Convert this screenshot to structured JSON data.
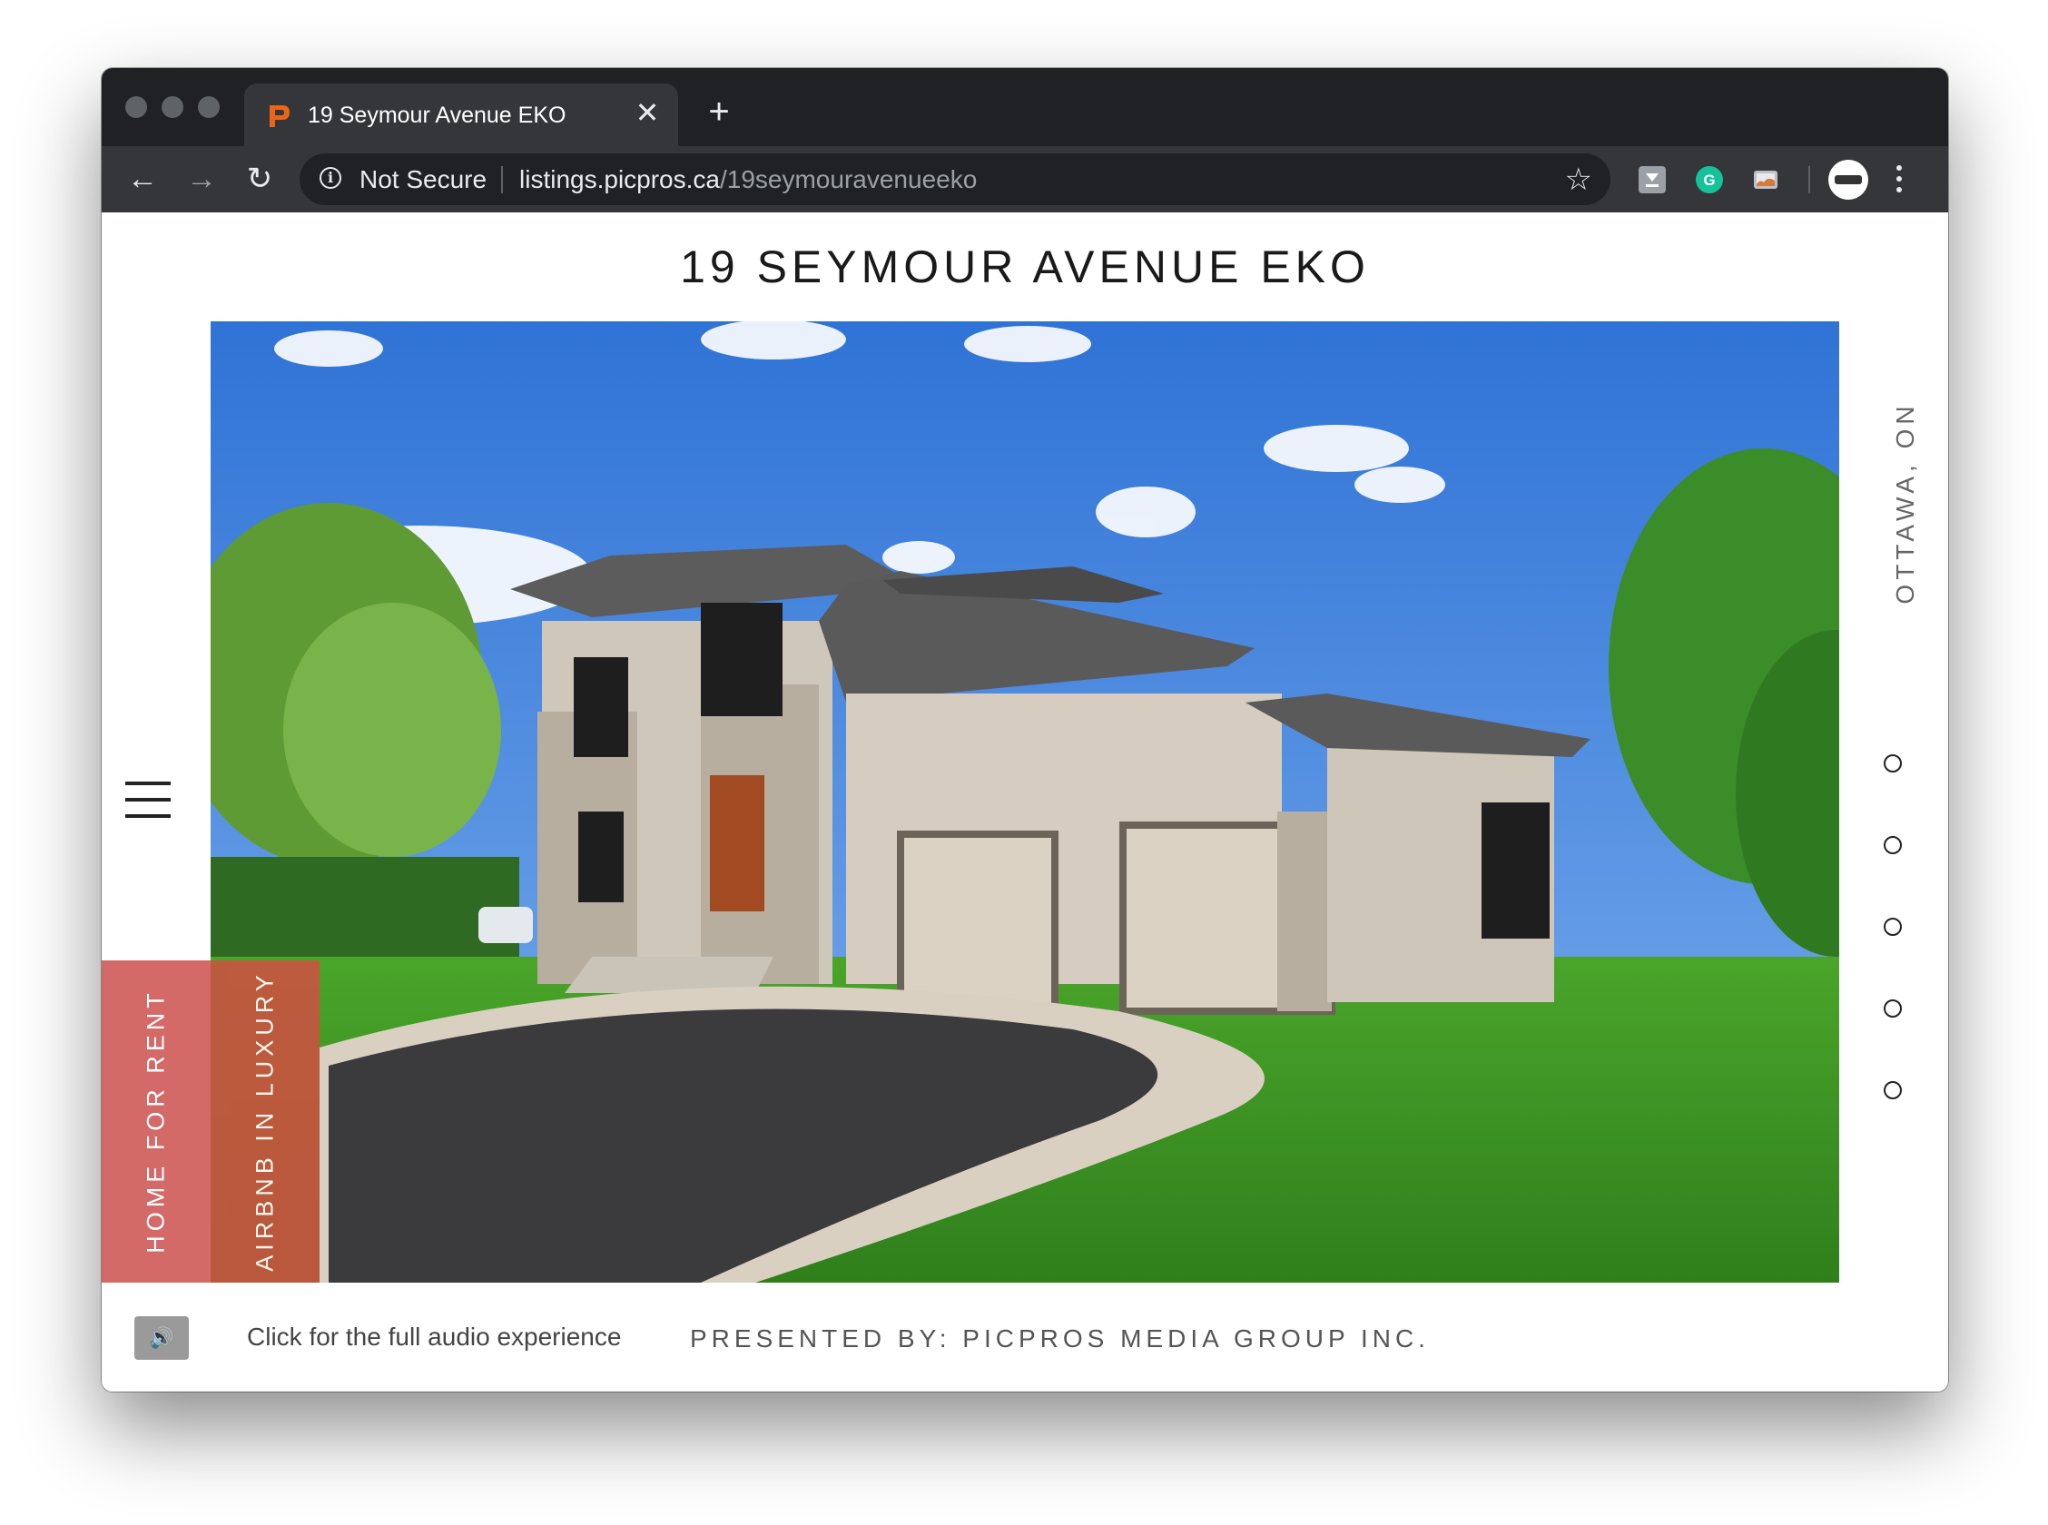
{
  "browser": {
    "tab": {
      "title": "19 Seymour Avenue EKO",
      "close_label": "✕"
    },
    "new_tab_label": "+",
    "nav": {
      "back": "←",
      "forward": "→",
      "reload": "↻"
    },
    "omnibox": {
      "security_label": "Not Secure",
      "url_host": "listings.picpros.ca",
      "url_path": "/19seymouravenueeko",
      "bookmark_icon": "☆"
    },
    "extensions": [
      "save-to-pocket-icon",
      "grammarly-icon",
      "cast-icon"
    ],
    "colors": {
      "chrome_dark": "#202124",
      "chrome_toolbar": "#35363a",
      "grammarly": "#15c39a"
    }
  },
  "page": {
    "title": "19 SEYMOUR AVENUE EKO",
    "location": "OTTAWA, ON",
    "slide_count": 5,
    "ribbons": [
      {
        "label": "HOME FOR RENT",
        "color": "#d46a68"
      },
      {
        "label": "AIRBNB IN LUXURY",
        "color": "#c65540"
      }
    ],
    "audio_icon": "🔊",
    "audio_prompt": "Click for the full audio experience",
    "presented_by": "PRESENTED BY: PICPROS MEDIA GROUP INC."
  }
}
